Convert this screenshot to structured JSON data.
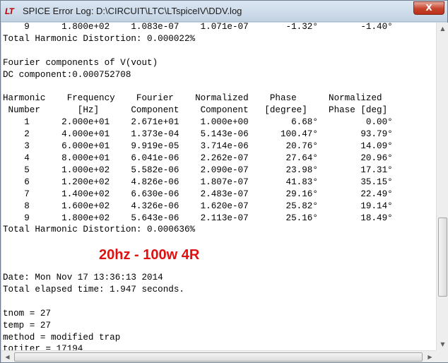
{
  "window": {
    "app_icon": "LT",
    "title": "SPICE Error Log: D:\\CIRCUIT\\LTC\\LTspiceIV\\DDV.log",
    "close_label": "X"
  },
  "log": {
    "lines": [
      "    9      1.800e+02    1.083e-07    1.071e-07       -1.32°        -1.40°",
      "Total Harmonic Distortion: 0.000022%",
      "",
      "Fourier components of V(vout)",
      "DC component:0.000752708",
      "",
      "Harmonic    Frequency    Fourier    Normalized    Phase      Normalized",
      " Number       [Hz]      Component    Component   [degree]    Phase [deg]",
      "    1      2.000e+01    2.671e+01    1.000e+00        6.68°         0.00°",
      "    2      4.000e+01    1.373e-04    5.143e-06      100.47°        93.79°",
      "    3      6.000e+01    9.919e-05    3.714e-06       20.76°        14.09°",
      "    4      8.000e+01    6.041e-06    2.262e-07       27.64°        20.96°",
      "    5      1.000e+02    5.582e-06    2.090e-07       23.98°        17.31°",
      "    6      1.200e+02    4.826e-06    1.807e-07       41.83°        35.15°",
      "    7      1.400e+02    6.630e-06    2.483e-07       29.16°        22.49°",
      "    8      1.600e+02    4.326e-06    1.620e-07       25.82°        19.14°",
      "    9      1.800e+02    5.643e-06    2.113e-07       25.16°        18.49°",
      "Total Harmonic Distortion: 0.000636%",
      "",
      "",
      "",
      "Date: Mon Nov 17 13:36:13 2014",
      "Total elapsed time: 1.947 seconds.",
      "",
      "tnom = 27",
      "temp = 27",
      "method = modified trap",
      "totiter = 17194"
    ],
    "annotation": "20hz - 100w 4R"
  },
  "scrollbars": {
    "up_arrow": "▲",
    "down_arrow": "▼",
    "left_arrow": "◀",
    "right_arrow": "▶"
  }
}
